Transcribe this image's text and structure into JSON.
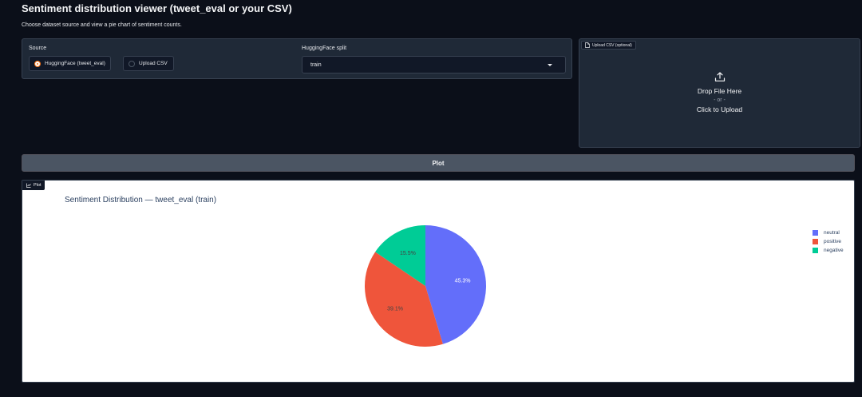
{
  "page": {
    "title": "Sentiment distribution viewer (tweet_eval or your CSV)",
    "description": "Choose dataset source and view a pie chart of sentiment counts."
  },
  "source": {
    "label": "Source",
    "options": [
      "HuggingFace (tweet_eval)",
      "Upload CSV"
    ],
    "selected": "HuggingFace (tweet_eval)"
  },
  "split": {
    "label": "HuggingFace split",
    "value": "train"
  },
  "upload": {
    "label": "Upload CSV (optional)",
    "drop_text": "Drop File Here",
    "or_text": "- or -",
    "click_text": "Click to Upload"
  },
  "plot_button": {
    "label": "Plot"
  },
  "plot_panel": {
    "label": "Plot"
  },
  "colors": {
    "accent": "#f97316",
    "neutral": "#636efa",
    "positive": "#ef553b",
    "negative": "#00cc96"
  },
  "chart_data": {
    "type": "pie",
    "title": "Sentiment Distribution — tweet_eval (train)",
    "labels": [
      "neutral",
      "positive",
      "negative"
    ],
    "values": [
      45.3,
      39.1,
      15.5
    ],
    "text_labels": [
      "45.3%",
      "39.1%",
      "15.5%"
    ],
    "colors": [
      "#636efa",
      "#ef553b",
      "#00cc96"
    ],
    "legend_position": "right"
  }
}
